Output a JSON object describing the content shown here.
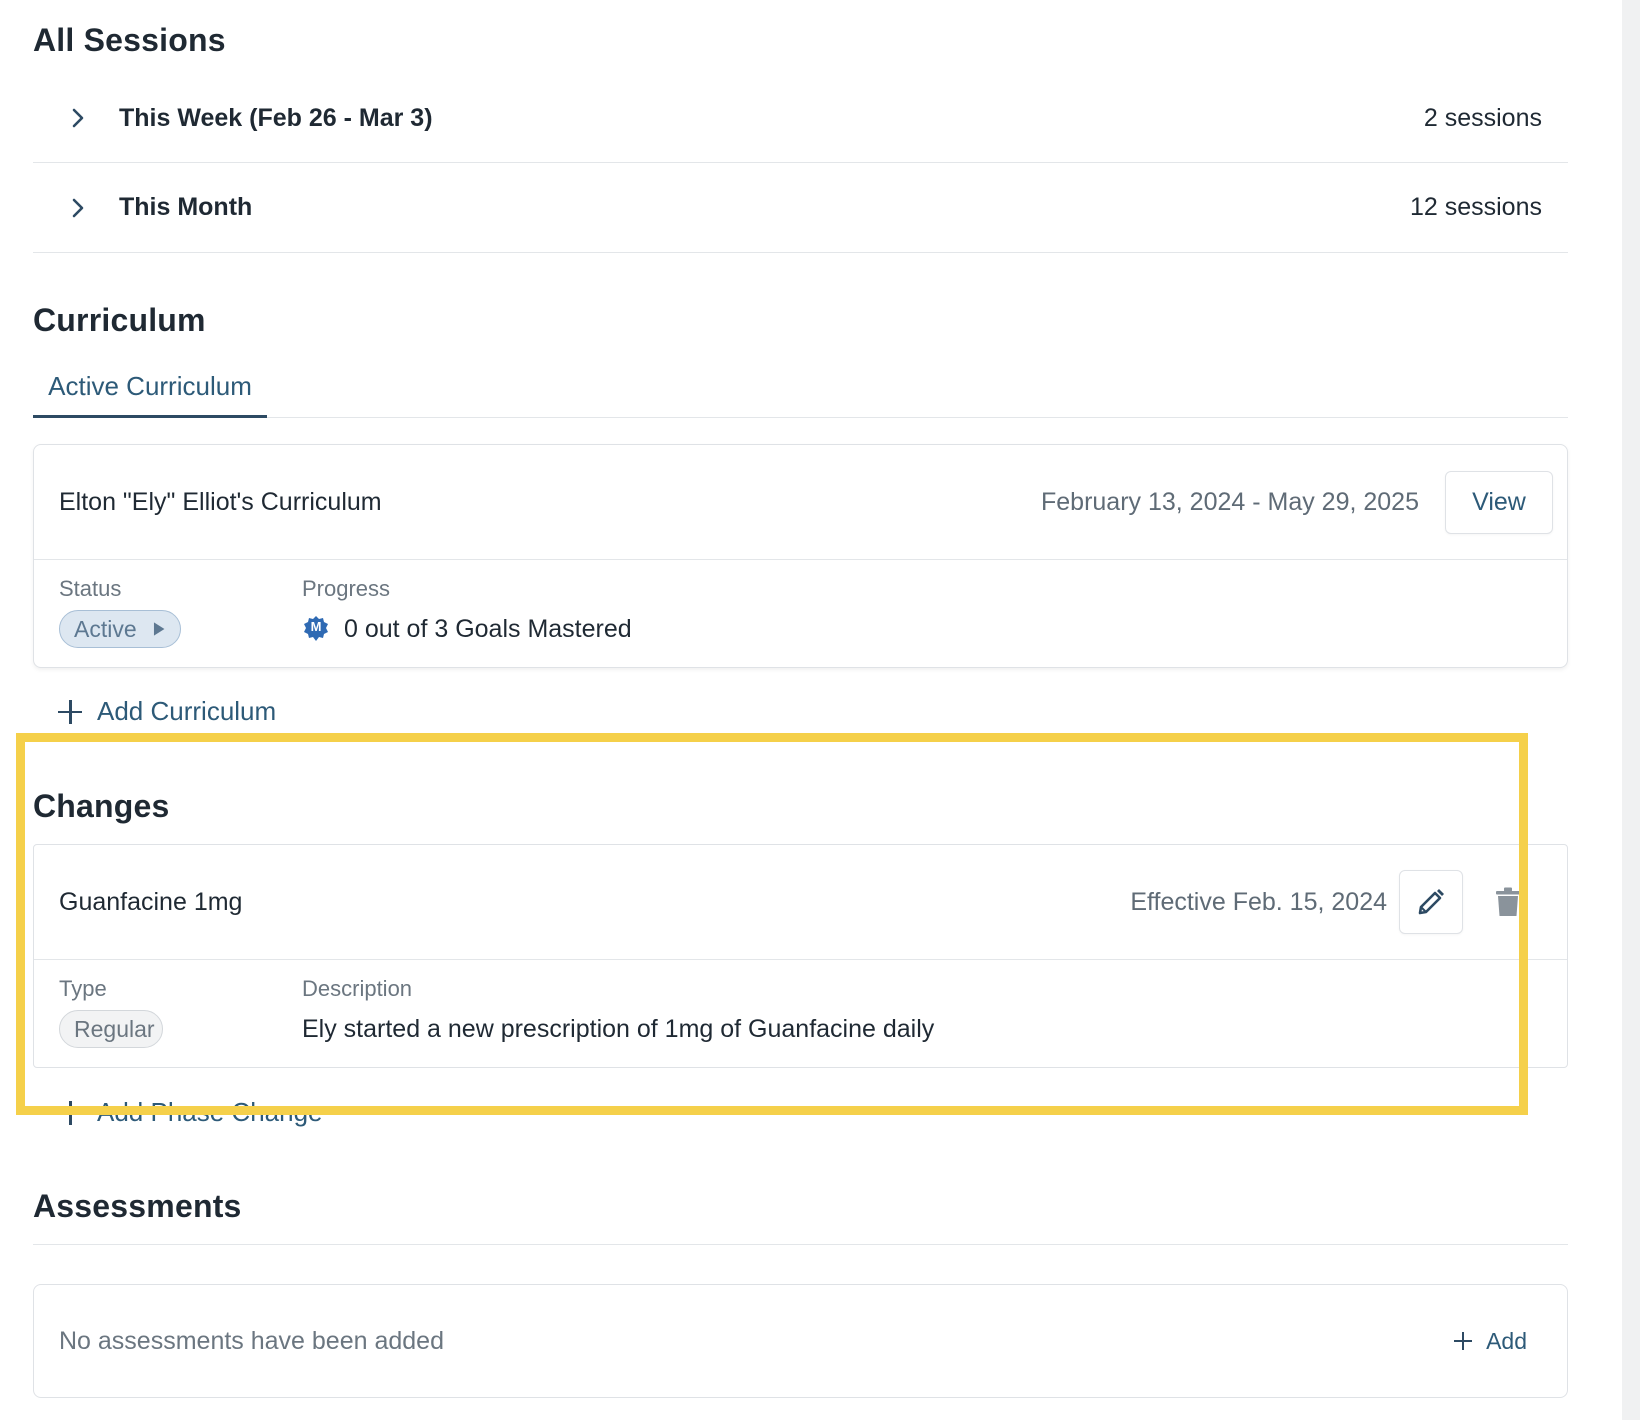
{
  "sessions": {
    "title": "All Sessions",
    "groups": [
      {
        "label": "This Week (Feb 26 - Mar 3)",
        "count": "2 sessions"
      },
      {
        "label": "This Month",
        "count": "12 sessions"
      }
    ]
  },
  "curriculum": {
    "title": "Curriculum",
    "tab_label": "Active Curriculum",
    "card": {
      "title": "Elton \"Ely\" Elliot's Curriculum",
      "date_range": "February 13, 2024 - May 29, 2025",
      "view_label": "View",
      "status_label": "Status",
      "status_value": "Active",
      "progress_label": "Progress",
      "progress_badge": "M",
      "progress_value": "0 out of 3 Goals Mastered"
    },
    "add_label": "Add Curriculum"
  },
  "changes": {
    "title": "Changes",
    "card": {
      "title": "Guanfacine 1mg",
      "effective": "Effective Feb. 15, 2024",
      "type_label": "Type",
      "type_value": "Regular",
      "description_label": "Description",
      "description_value": "Ely started a new prescription of 1mg of Guanfacine daily"
    },
    "add_label": "Add Phase Change",
    "highlight_color": "#f5d04a"
  },
  "assessments": {
    "title": "Assessments",
    "empty_text": "No assessments have been added",
    "add_label": "Add"
  },
  "colors": {
    "accent": "#2d5a78",
    "status_active_bg": "#dde7f1"
  }
}
